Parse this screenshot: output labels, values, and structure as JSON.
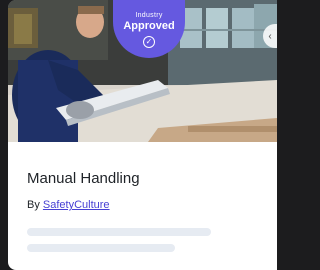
{
  "card": {
    "badge": {
      "line1": "Industry",
      "line2": "Approved",
      "check_icon": "check-circle-icon"
    },
    "title": "Manual Handling",
    "by_prefix": "By",
    "author": "SafetyCulture",
    "hero_image": "worker-lifting-glass-panel",
    "colors": {
      "badge": "#6559e0",
      "link": "#4740d4",
      "skeleton": "#e6ebf2"
    }
  }
}
